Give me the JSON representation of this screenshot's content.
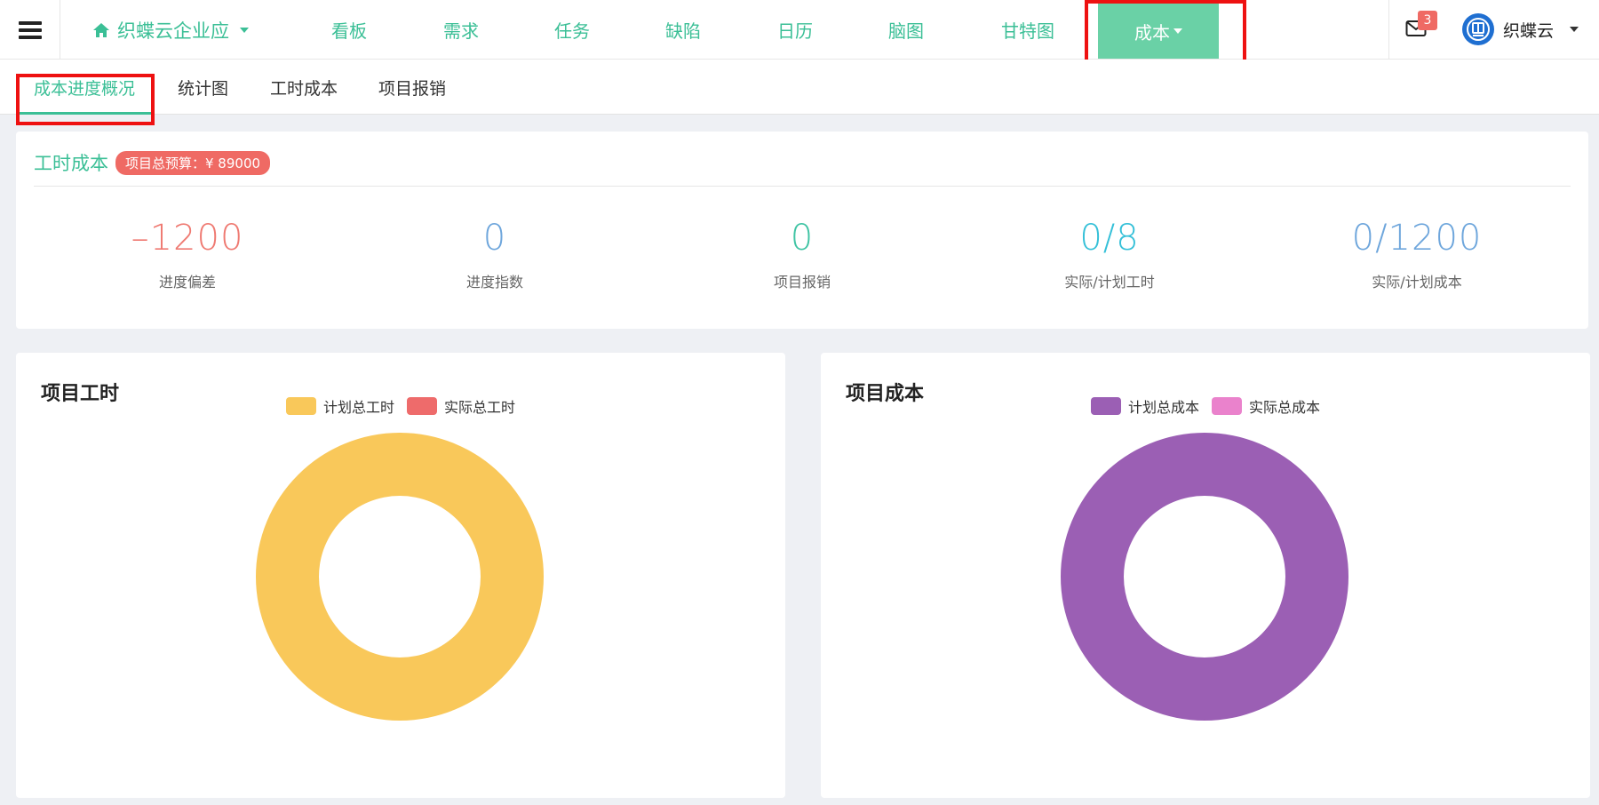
{
  "colors": {
    "brand": "#3bbf96",
    "nav_active_bg": "#6ad1a6",
    "danger": "#ef6a64",
    "highlight": "#ee1111"
  },
  "navbar": {
    "menu_icon": "hamburger-icon",
    "project": {
      "icon": "home-icon",
      "label": "织蝶云企业应"
    },
    "items": [
      {
        "label": "看板"
      },
      {
        "label": "需求"
      },
      {
        "label": "任务"
      },
      {
        "label": "缺陷"
      },
      {
        "label": "日历"
      },
      {
        "label": "脑图"
      },
      {
        "label": "甘特图"
      },
      {
        "label": "成本",
        "active": true,
        "dropdown": true
      }
    ],
    "mail": {
      "icon": "mail-icon",
      "count": "3"
    },
    "user": {
      "name": "织蝶云",
      "avatar_icon": "logo-icon"
    }
  },
  "subtabs": [
    {
      "label": "成本进度概况",
      "active": true
    },
    {
      "label": "统计图"
    },
    {
      "label": "工时成本"
    },
    {
      "label": "项目报销"
    }
  ],
  "summary": {
    "title": "工时成本",
    "budget_badge": "项目总预算：¥ 89000",
    "stats": [
      {
        "value": "–1200",
        "label": "进度偏差",
        "color": "#ef7a72"
      },
      {
        "value": "0",
        "label": "进度指数",
        "color": "#6ea6dc"
      },
      {
        "value": "0",
        "label": "项目报销",
        "color": "#40c4a4"
      },
      {
        "value": "0/8",
        "label": "实际/计划工时",
        "color": "#35c0d8"
      },
      {
        "value": "0/1200",
        "label": "实际/计划成本",
        "color": "#6ea6dc"
      }
    ]
  },
  "chart_data": [
    {
      "type": "pie",
      "title": "项目工时",
      "labels": [
        "计划总工时",
        "实际总工时"
      ],
      "values": [
        8,
        0
      ],
      "colors": [
        "#f9c85a",
        "#ee6b6b"
      ],
      "legend": "top-center"
    },
    {
      "type": "pie",
      "title": "项目成本",
      "labels": [
        "计划总成本",
        "实际总成本"
      ],
      "values": [
        1200,
        0
      ],
      "colors": [
        "#9b5fb4",
        "#ea82cc"
      ],
      "legend": "top-center"
    }
  ]
}
